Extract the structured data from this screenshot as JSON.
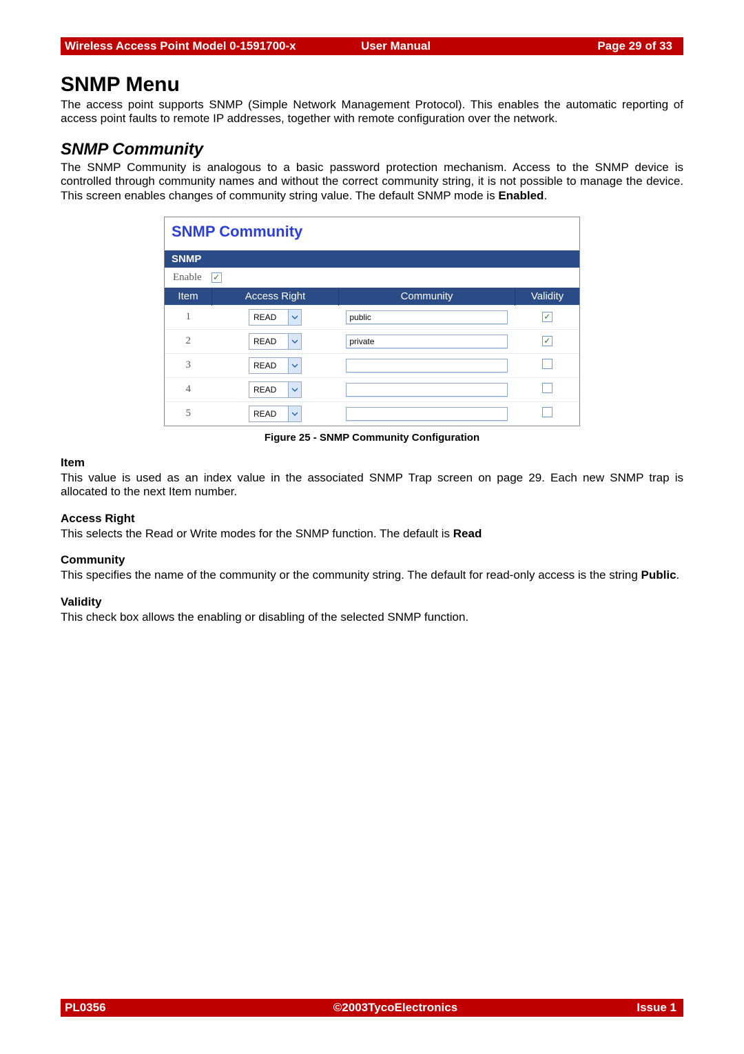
{
  "header": {
    "left": "Wireless Access Point  Model 0-1591700-x",
    "mid": "User Manual",
    "right": "Page 29 of 33"
  },
  "footer": {
    "left": "PL0356",
    "mid": "©2003TycoElectronics",
    "right": "Issue 1"
  },
  "h1": "SNMP Menu",
  "p1": "The access point supports SNMP (Simple Network Management Protocol). This enables the automatic reporting of access point faults to remote IP addresses, together with remote configuration over the network.",
  "h2": "SNMP Community",
  "p2a": "The SNMP Community is analogous to a basic password protection mechanism. Access to the SNMP device is controlled through community names and without the correct community string, it is not possible to manage the device. This screen enables changes of community string value. The default SNMP mode is ",
  "p2bold": "Enabled",
  "p2end": ".",
  "figure": {
    "title": "SNMP Community",
    "snmp_bar": "SNMP",
    "enable_label": "Enable",
    "enable_checked": true,
    "columns": {
      "item": "Item",
      "access": "Access Right",
      "community": "Community",
      "validity": "Validity"
    },
    "dropdown_value": "READ",
    "rows": [
      {
        "item": "1",
        "community": "public",
        "validity": true
      },
      {
        "item": "2",
        "community": "private",
        "validity": true
      },
      {
        "item": "3",
        "community": "",
        "validity": false
      },
      {
        "item": "4",
        "community": "",
        "validity": false
      },
      {
        "item": "5",
        "community": "",
        "validity": false
      }
    ],
    "caption": "Figure 25 - SNMP Community Configuration"
  },
  "sections": {
    "item_h": "Item",
    "item_p": "This value is used as an index value in the associated SNMP Trap screen on page 29. Each new SNMP trap is allocated to the next Item number.",
    "ar_h": "Access Right",
    "ar_p_a": "This selects the Read or Write modes for the SNMP function. The default is ",
    "ar_p_bold": "Read",
    "comm_h": "Community",
    "comm_p_a": "This specifies the name of the community or the community string. The default for read-only access is the string ",
    "comm_p_bold": "Public",
    "comm_p_end": ".",
    "val_h": "Validity",
    "val_p": "This check box allows the enabling or disabling of the selected SNMP function."
  }
}
